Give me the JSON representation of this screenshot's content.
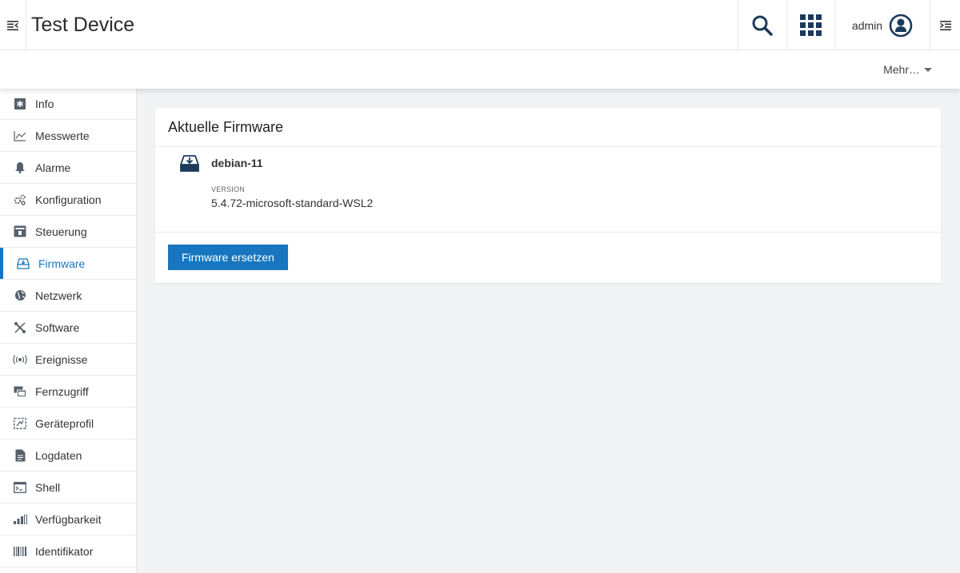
{
  "header": {
    "title": "Test Device",
    "user": "admin"
  },
  "subheader": {
    "more_label": "Mehr…"
  },
  "sidebar": {
    "items": [
      {
        "label": "Info",
        "icon": "info-icon"
      },
      {
        "label": "Messwerte",
        "icon": "chart-line-icon"
      },
      {
        "label": "Alarme",
        "icon": "bell-icon"
      },
      {
        "label": "Konfiguration",
        "icon": "cogs-icon"
      },
      {
        "label": "Steuerung",
        "icon": "control-icon"
      },
      {
        "label": "Firmware",
        "icon": "firmware-icon"
      },
      {
        "label": "Netzwerk",
        "icon": "globe-icon"
      },
      {
        "label": "Software",
        "icon": "tools-icon"
      },
      {
        "label": "Ereignisse",
        "icon": "broadcast-icon"
      },
      {
        "label": "Fernzugriff",
        "icon": "remote-access-icon"
      },
      {
        "label": "Geräteprofil",
        "icon": "device-profile-icon"
      },
      {
        "label": "Logdaten",
        "icon": "log-file-icon"
      },
      {
        "label": "Shell",
        "icon": "terminal-icon"
      },
      {
        "label": "Verfügbarkeit",
        "icon": "bar-chart-icon"
      },
      {
        "label": "Identifikator",
        "icon": "barcode-icon"
      }
    ],
    "active": "Firmware"
  },
  "firmware_card": {
    "title": "Aktuelle Firmware",
    "name": "debian-11",
    "version_label": "VERSION",
    "version_value": "5.4.72-microsoft-standard-WSL2",
    "replace_button": "Firmware ersetzen"
  },
  "colors": {
    "accent": "#1776bf",
    "background": "#f2f3f4",
    "icon_dark": "#1b3a5c"
  }
}
